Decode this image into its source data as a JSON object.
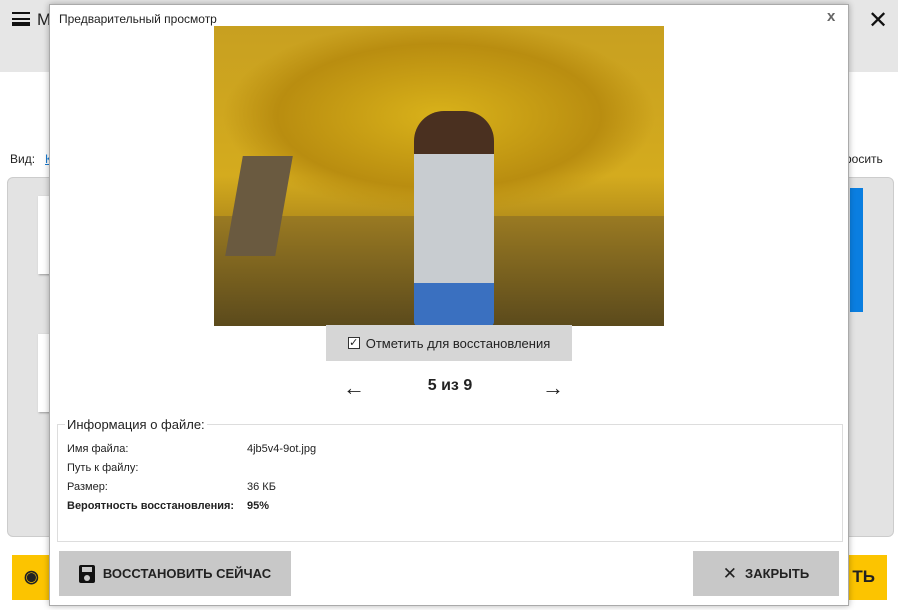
{
  "app": {
    "title": "М",
    "close": "✕",
    "view_label": "Вид:",
    "view_link": "К",
    "reset_link": "росить",
    "yellow_left_icon": "◉",
    "yellow_right_label": "ТЬ"
  },
  "dialog": {
    "title": "Предварительный просмотр",
    "close": "x",
    "mark_label": "Отметить для восстановления",
    "mark_checked": true,
    "prev": "←",
    "next": "→",
    "counter": "5 из 9",
    "info": {
      "legend": "Информация о файле:",
      "rows": [
        {
          "label": "Имя файла:",
          "value": "4jb5v4-9ot.jpg"
        },
        {
          "label": "Путь к файлу:",
          "value": ""
        },
        {
          "label": "Размер:",
          "value": "36 КБ"
        },
        {
          "label": "Вероятность восстановления:",
          "value": "95%"
        }
      ]
    },
    "restore_label": "ВОССТАНОВИТЬ СЕЙЧАС",
    "close_label": "ЗАКРЫТЬ",
    "close_icon": "✕"
  }
}
